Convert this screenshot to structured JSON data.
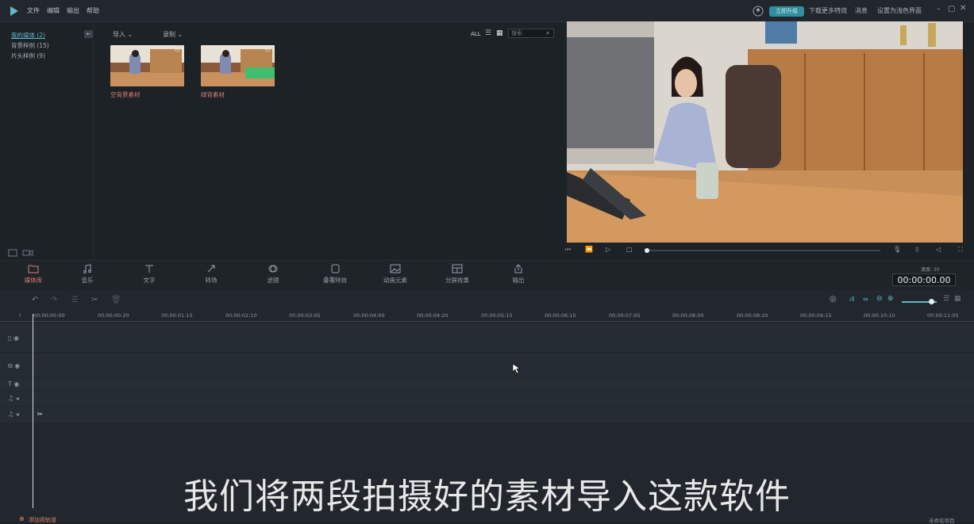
{
  "menu": {
    "file": "文件",
    "edit": "编辑",
    "export": "输出",
    "help": "帮助"
  },
  "topbar": {
    "upgrade": "立即升级",
    "download_effects": "下载更多特效",
    "messages": "消息",
    "theme": "设置为浅色界面"
  },
  "sidebar": {
    "items": [
      "我的媒体 (2)",
      "背景样例 (15)",
      "片头样例 (9)"
    ]
  },
  "media": {
    "import": "导入",
    "record": "录制",
    "all": "ALL",
    "search_placeholder": "搜索",
    "clips": [
      {
        "label": "空背景素材"
      },
      {
        "label": "绿背素材"
      }
    ]
  },
  "tools": [
    "媒体库",
    "音乐",
    "文字",
    "转场",
    "滤镜",
    "叠覆特效",
    "动画元素",
    "分屏效果",
    "输出"
  ],
  "timeline": {
    "fps_label": "速度: 30",
    "timecode": "00:00:00.00",
    "ruler": [
      "00:00:00:00",
      "00:00:00:20",
      "00:00:01:15",
      "00:00:02:10",
      "00:00:03:05",
      "00:00:04:00",
      "00:00:04:20",
      "00:00:05:15",
      "00:00:06:10",
      "00:00:07:05",
      "00:00:08:00",
      "00:00:08:20",
      "00:00:09:15",
      "00:00:10:10",
      "00:00:11:05"
    ]
  },
  "subtitle": "我们将两段拍摄好的素材导入这款软件",
  "status": {
    "add_track": "添加视轨道",
    "project_name": "未命名项目"
  },
  "colors": {
    "accent": "#2f8ea0",
    "active_tab": "#d9806e"
  }
}
